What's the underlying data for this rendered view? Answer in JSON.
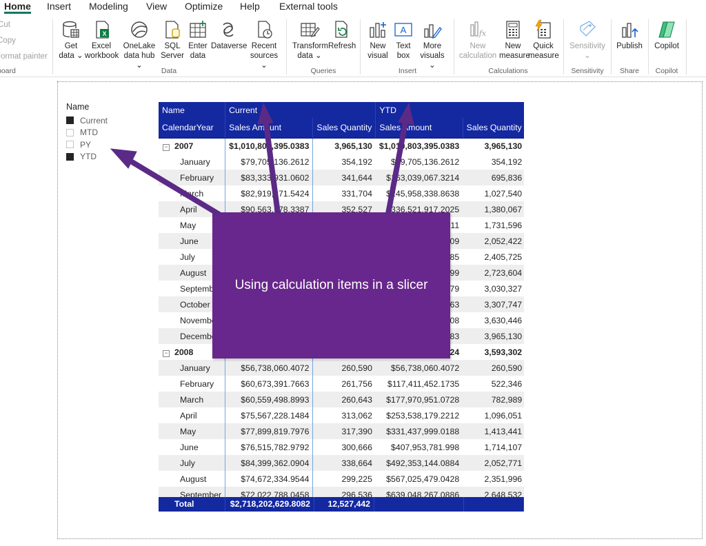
{
  "ribbon_tabs": [
    {
      "label": "Home",
      "active": true
    },
    {
      "label": "Insert"
    },
    {
      "label": "Modeling"
    },
    {
      "label": "View"
    },
    {
      "label": "Optimize"
    },
    {
      "label": "Help"
    },
    {
      "label": "External tools"
    }
  ],
  "clipboard": {
    "cut": "Cut",
    "copy": "Copy",
    "format_painter": "Format painter",
    "group": "board"
  },
  "data_group": {
    "label": "Data",
    "buttons": {
      "get_data": [
        "Get",
        "data ⌄"
      ],
      "excel": [
        "Excel",
        "workbook"
      ],
      "onelake": [
        "OneLake",
        "data hub ⌄"
      ],
      "sql": [
        "SQL",
        "Server"
      ],
      "enter": [
        "Enter",
        "data"
      ],
      "dataverse": [
        "Dataverse",
        ""
      ],
      "recent": [
        "Recent",
        "sources ⌄"
      ]
    }
  },
  "queries_group": {
    "label": "Queries",
    "buttons": {
      "transform": [
        "Transform",
        "data ⌄"
      ],
      "refresh": [
        "Refresh",
        ""
      ]
    }
  },
  "insert_group": {
    "label": "Insert",
    "buttons": {
      "new_visual": [
        "New",
        "visual"
      ],
      "text_box": [
        "Text",
        "box"
      ],
      "more_visuals": [
        "More",
        "visuals ⌄"
      ]
    }
  },
  "calc_group": {
    "label": "Calculations",
    "buttons": {
      "new_calc": [
        "New",
        "calculation"
      ],
      "new_measure": [
        "New",
        "measure"
      ],
      "quick_measure": [
        "Quick",
        "measure"
      ]
    }
  },
  "sensitivity_group": {
    "label": "Sensitivity",
    "button": [
      "Sensitivity",
      "⌄"
    ]
  },
  "share_group": {
    "label": "Share",
    "button": "Publish"
  },
  "copilot_group": {
    "label": "Copilot",
    "button": "Copilot"
  },
  "slicer": {
    "title": "Name",
    "items": [
      {
        "label": "Current",
        "checked": true
      },
      {
        "label": "MTD",
        "checked": false
      },
      {
        "label": "PY",
        "checked": false
      },
      {
        "label": "YTD",
        "checked": true
      }
    ]
  },
  "matrix": {
    "header1": {
      "name": "Name",
      "current": "Current",
      "ytd": "YTD"
    },
    "header2": {
      "row_field": "CalendarYear",
      "c_amount": "Sales Amount",
      "c_qty": "Sales Quantity",
      "y_amount": "Sales Amount",
      "y_qty": "Sales Quantity"
    },
    "rows": [
      {
        "type": "year",
        "label": "2007",
        "c_amount": "$1,010,803,395.0383",
        "c_qty": "3,965,130",
        "y_amount": "$1,010,803,395.0383",
        "y_qty": "3,965,130"
      },
      {
        "type": "month",
        "label": "January",
        "c_amount": "$79,705,136.2612",
        "c_qty": "354,192",
        "y_amount": "$79,705,136.2612",
        "y_qty": "354,192"
      },
      {
        "type": "month",
        "label": "February",
        "c_amount": "$83,333,931.0602",
        "c_qty": "341,644",
        "y_amount": "$163,039,067.3214",
        "y_qty": "695,836"
      },
      {
        "type": "month",
        "label": "March",
        "c_amount": "$82,919,271.5424",
        "c_qty": "331,704",
        "y_amount": "$245,958,338.8638",
        "y_qty": "1,027,540"
      },
      {
        "type": "month",
        "label": "April",
        "c_amount": "$90,563,578.3387",
        "c_qty": "352,527",
        "y_amount": "$336,521,917.2025",
        "y_qty": "1,380,067"
      },
      {
        "type": "month",
        "label": "May",
        "c_amount": "",
        "c_qty": "",
        "y_amount": "11",
        "y_qty": "1,731,596"
      },
      {
        "type": "month",
        "label": "June",
        "c_amount": "",
        "c_qty": "",
        "y_amount": "09",
        "y_qty": "2,052,422"
      },
      {
        "type": "month",
        "label": "July",
        "c_amount": "",
        "c_qty": "",
        "y_amount": "85",
        "y_qty": "2,405,725"
      },
      {
        "type": "month",
        "label": "August",
        "c_amount": "",
        "c_qty": "",
        "y_amount": "99",
        "y_qty": "2,723,604"
      },
      {
        "type": "month",
        "label": "September",
        "c_amount": "",
        "c_qty": "",
        "y_amount": "79",
        "y_qty": "3,030,327"
      },
      {
        "type": "month",
        "label": "October",
        "c_amount": "",
        "c_qty": "",
        "y_amount": "63",
        "y_qty": "3,307,747"
      },
      {
        "type": "month",
        "label": "November",
        "c_amount": "",
        "c_qty": "",
        "y_amount": "08",
        "y_qty": "3,630,446"
      },
      {
        "type": "month",
        "label": "December",
        "c_amount": "",
        "c_qty": "",
        "y_amount": "83",
        "y_qty": "3,965,130"
      },
      {
        "type": "year",
        "label": "2008",
        "c_amount": "",
        "c_qty": "",
        "y_amount": "24",
        "y_qty": "3,593,302"
      },
      {
        "type": "month",
        "label": "January",
        "c_amount": "$56,738,060.4072",
        "c_qty": "260,590",
        "y_amount": "$56,738,060.4072",
        "y_qty": "260,590"
      },
      {
        "type": "month",
        "label": "February",
        "c_amount": "$60,673,391.7663",
        "c_qty": "261,756",
        "y_amount": "$117,411,452.1735",
        "y_qty": "522,346"
      },
      {
        "type": "month",
        "label": "March",
        "c_amount": "$60,559,498.8993",
        "c_qty": "260,643",
        "y_amount": "$177,970,951.0728",
        "y_qty": "782,989"
      },
      {
        "type": "month",
        "label": "April",
        "c_amount": "$75,567,228.1484",
        "c_qty": "313,062",
        "y_amount": "$253,538,179.2212",
        "y_qty": "1,096,051"
      },
      {
        "type": "month",
        "label": "May",
        "c_amount": "$77,899,819.7976",
        "c_qty": "317,390",
        "y_amount": "$331,437,999.0188",
        "y_qty": "1,413,441"
      },
      {
        "type": "month",
        "label": "June",
        "c_amount": "$76,515,782.9792",
        "c_qty": "300,666",
        "y_amount": "$407,953,781.998",
        "y_qty": "1,714,107"
      },
      {
        "type": "month",
        "label": "July",
        "c_amount": "$84,399,362.0904",
        "c_qty": "338,664",
        "y_amount": "$492,353,144.0884",
        "y_qty": "2,052,771"
      },
      {
        "type": "month",
        "label": "August",
        "c_amount": "$74,672,334.9544",
        "c_qty": "299,225",
        "y_amount": "$567,025,479.0428",
        "y_qty": "2,351,996"
      },
      {
        "type": "month",
        "label": "September",
        "c_amount": "$72,022,788.0458",
        "c_qty": "296,536",
        "y_amount": "$639,048,267.0886",
        "y_qty": "2,648,532"
      }
    ],
    "total": {
      "label": "Total",
      "c_amount": "$2,718,202,629.8082",
      "c_qty": "12,527,442"
    }
  },
  "callout": {
    "text": "Using calculation items in a slicer"
  },
  "colors": {
    "header_blue": "#1428a0",
    "callout_purple": "#68278c",
    "arrow_purple": "#5b2a86"
  }
}
